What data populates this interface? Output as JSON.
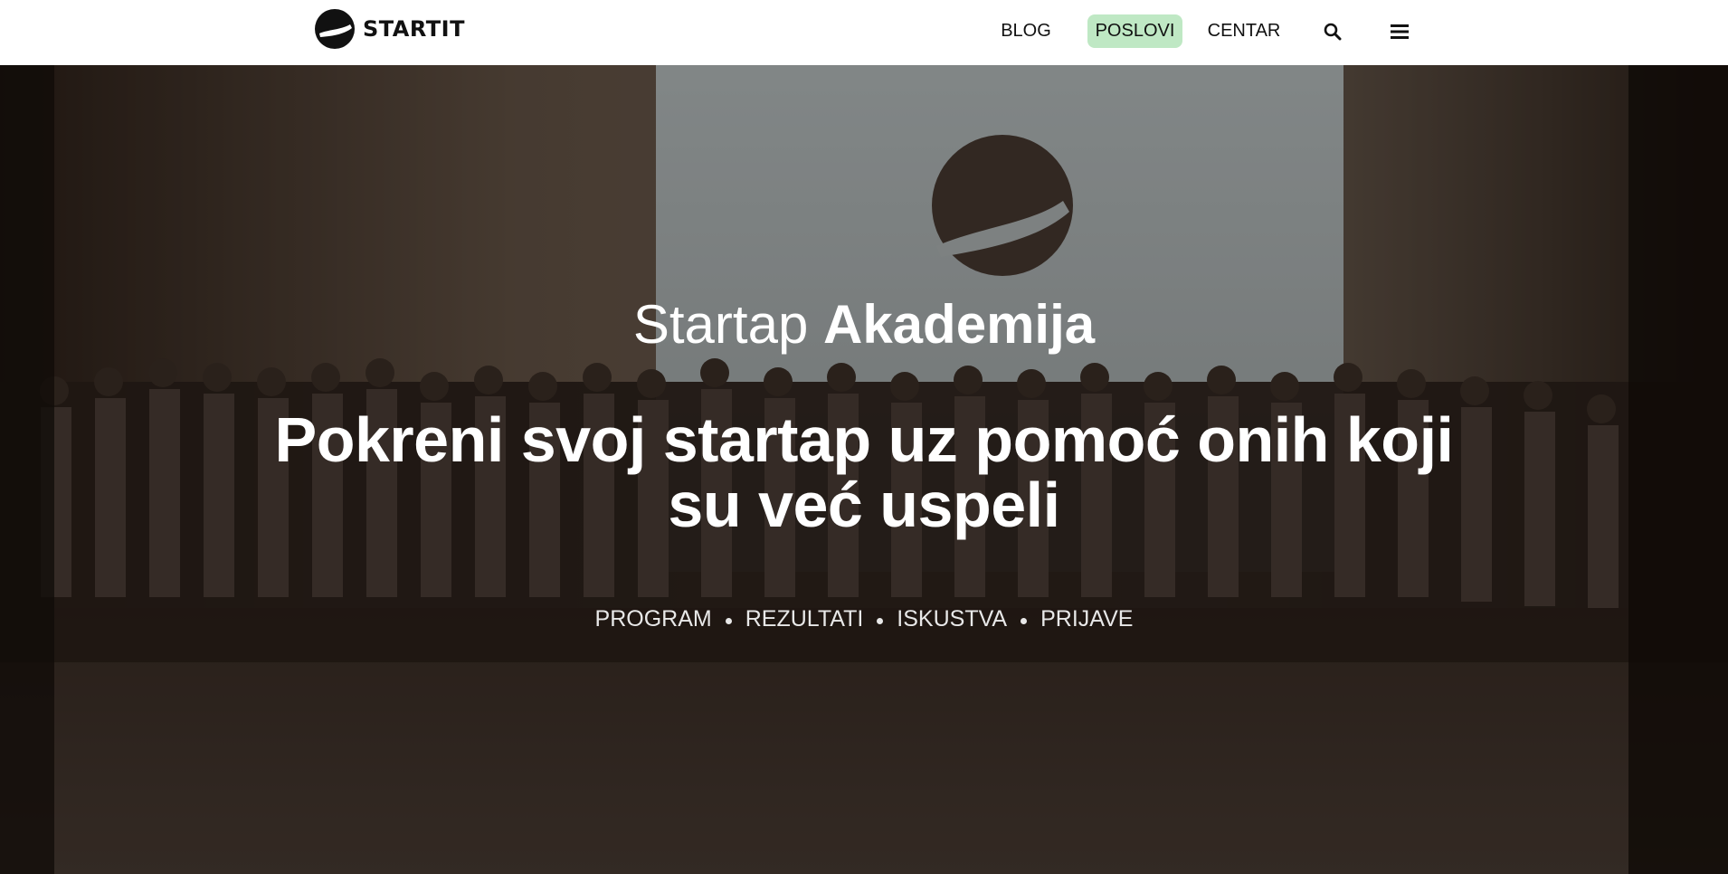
{
  "header": {
    "brand": "STARTIT",
    "nav": [
      {
        "label": "BLOG"
      },
      {
        "label": "POSLOVI",
        "active": true
      },
      {
        "label": "CENTAR"
      }
    ],
    "icons": [
      "search-icon",
      "hamburger-menu-icon"
    ],
    "active_highlight_color": "#bfe8c4"
  },
  "hero": {
    "eyebrow_light": "Startap",
    "eyebrow_bold": "Akademija",
    "headline": "Pokreni svoj startap uz pomoć onih koji su već uspeli",
    "links": [
      {
        "label": "PROGRAM"
      },
      {
        "label": "REZULTATI"
      },
      {
        "label": "ISKUSTVA"
      },
      {
        "label": "PRIJAVE"
      }
    ]
  },
  "colors": {
    "header_bg": "#ffffff",
    "text_on_hero": "#ffffff"
  }
}
